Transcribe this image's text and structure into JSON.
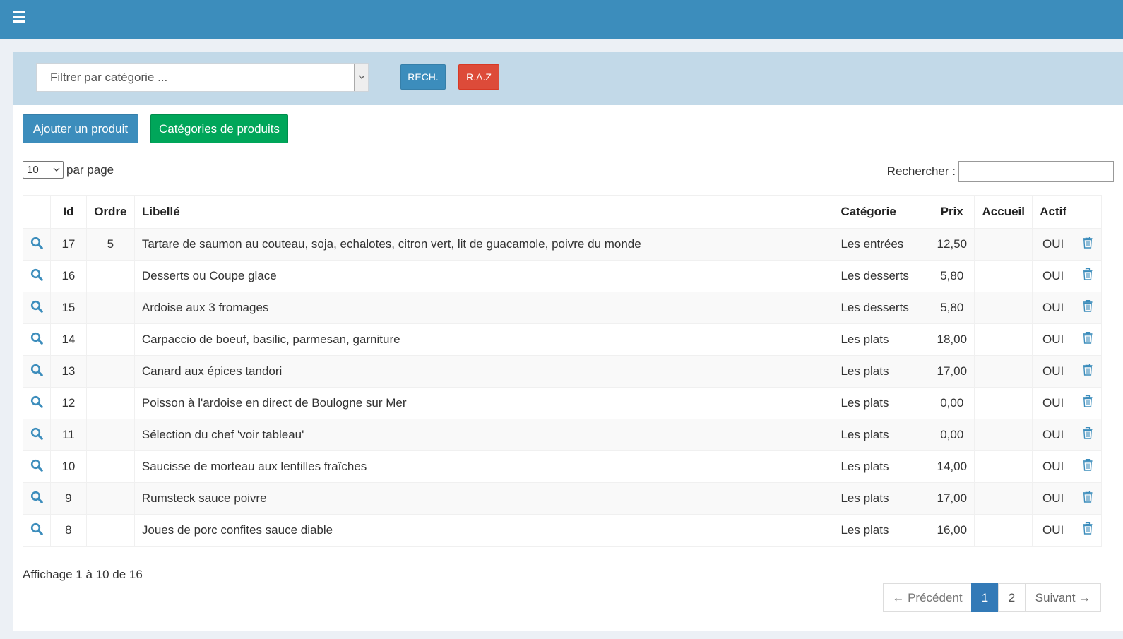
{
  "header": {
    "menu_icon": "hamburger-icon"
  },
  "filter": {
    "category_placeholder": "Filtrer par catégorie ...",
    "search_button": "RECH.",
    "reset_button": "R.A.Z"
  },
  "actions": {
    "add_product": "Ajouter un produit",
    "product_categories": "Catégories de produits"
  },
  "table_controls": {
    "per_page_value": "10",
    "per_page_label": "par page",
    "search_label": "Rechercher :"
  },
  "table": {
    "headers": {
      "id": "Id",
      "ordre": "Ordre",
      "libelle": "Libellé",
      "categorie": "Catégorie",
      "prix": "Prix",
      "accueil": "Accueil",
      "actif": "Actif"
    },
    "rows": [
      {
        "id": "17",
        "ordre": "5",
        "libelle": "Tartare de saumon au couteau, soja, echalotes, citron vert, lit de guacamole, poivre du monde",
        "categorie": "Les entrées",
        "prix": "12,50",
        "accueil": "",
        "actif": "OUI"
      },
      {
        "id": "16",
        "ordre": "",
        "libelle": "Desserts ou Coupe glace",
        "categorie": "Les desserts",
        "prix": "5,80",
        "accueil": "",
        "actif": "OUI"
      },
      {
        "id": "15",
        "ordre": "",
        "libelle": "Ardoise aux 3 fromages",
        "categorie": "Les desserts",
        "prix": "5,80",
        "accueil": "",
        "actif": "OUI"
      },
      {
        "id": "14",
        "ordre": "",
        "libelle": "Carpaccio de boeuf, basilic, parmesan, garniture",
        "categorie": "Les plats",
        "prix": "18,00",
        "accueil": "",
        "actif": "OUI"
      },
      {
        "id": "13",
        "ordre": "",
        "libelle": "Canard aux épices tandori",
        "categorie": "Les plats",
        "prix": "17,00",
        "accueil": "",
        "actif": "OUI"
      },
      {
        "id": "12",
        "ordre": "",
        "libelle": "Poisson à l'ardoise en direct de Boulogne sur Mer",
        "categorie": "Les plats",
        "prix": "0,00",
        "accueil": "",
        "actif": "OUI"
      },
      {
        "id": "11",
        "ordre": "",
        "libelle": "Sélection du chef 'voir tableau'",
        "categorie": "Les plats",
        "prix": "0,00",
        "accueil": "",
        "actif": "OUI"
      },
      {
        "id": "10",
        "ordre": "",
        "libelle": "Saucisse de morteau aux lentilles fraîches",
        "categorie": "Les plats",
        "prix": "14,00",
        "accueil": "",
        "actif": "OUI"
      },
      {
        "id": "9",
        "ordre": "",
        "libelle": "Rumsteck sauce poivre",
        "categorie": "Les plats",
        "prix": "17,00",
        "accueil": "",
        "actif": "OUI"
      },
      {
        "id": "8",
        "ordre": "",
        "libelle": "Joues de porc confites sauce diable",
        "categorie": "Les plats",
        "prix": "16,00",
        "accueil": "",
        "actif": "OUI"
      }
    ],
    "row_view_icon": "search-icon",
    "row_delete_icon": "trash-icon"
  },
  "footer": {
    "info": "Affichage 1 à 10 de 16",
    "prev": "← Précédent",
    "pages": [
      "1",
      "2"
    ],
    "current_page": "1",
    "next": "Suivant →"
  },
  "colors": {
    "primary": "#3c8dbc",
    "success": "#00a65a",
    "danger": "#dd4b39",
    "filter_bg": "#c2d9e8",
    "pager_active": "#337ab7"
  }
}
